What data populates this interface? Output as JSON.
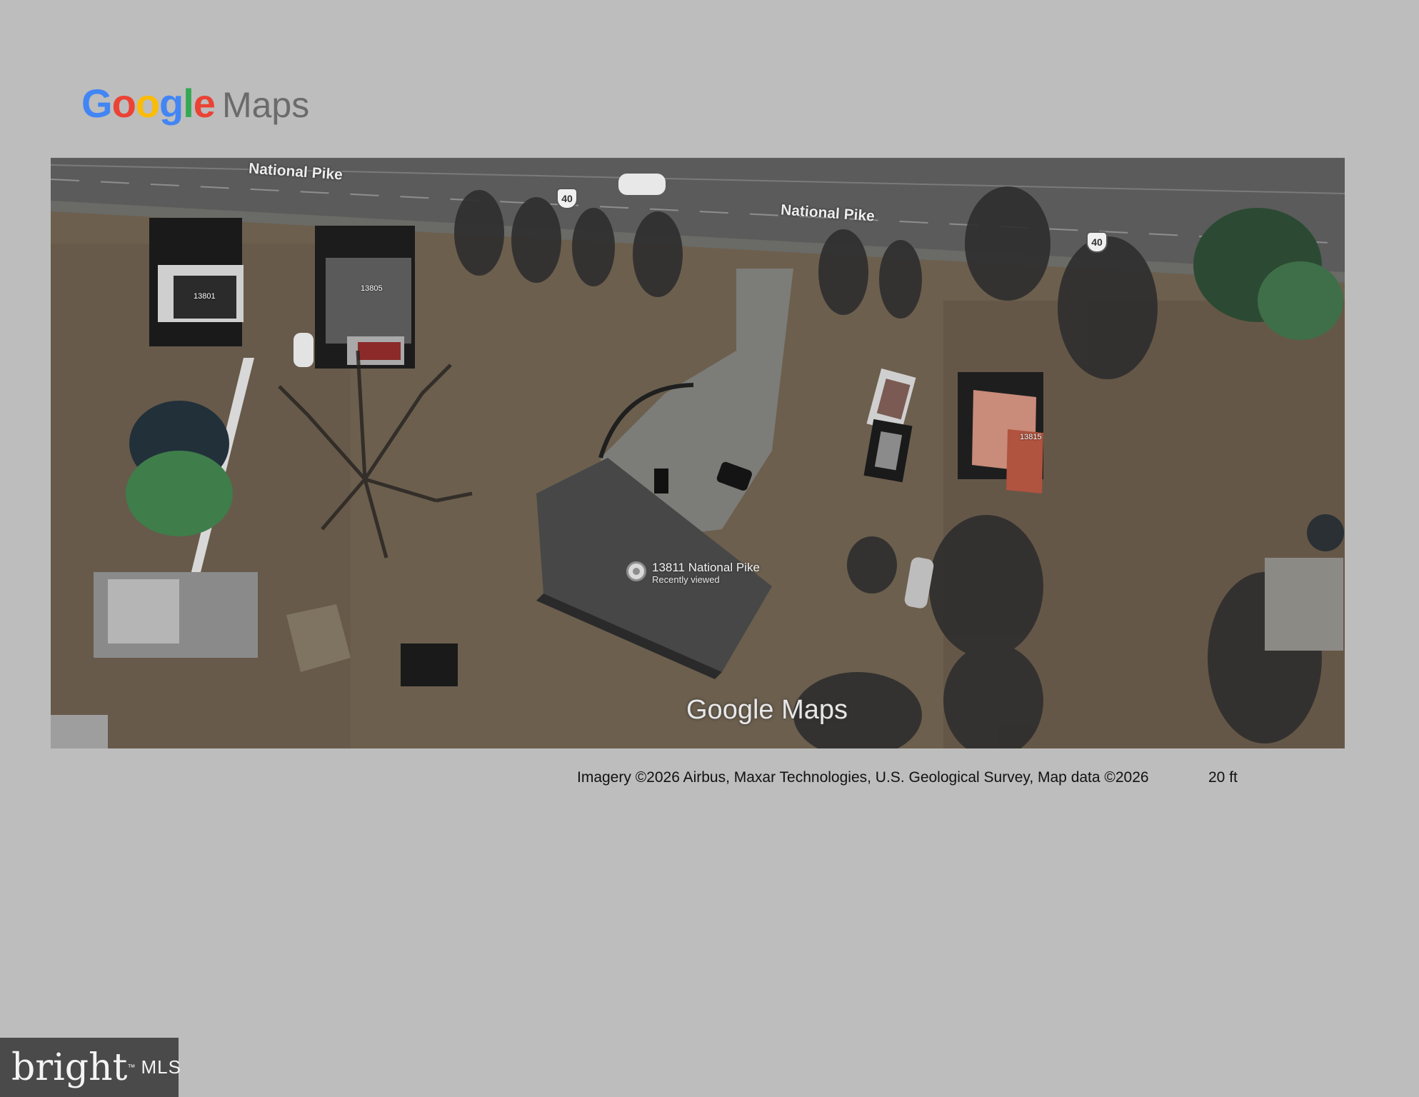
{
  "header": {
    "logo_google": "Google",
    "logo_maps": "Maps",
    "logo_colors": [
      "#4285F4",
      "#EA4335",
      "#FBBC05",
      "#4285F4",
      "#34A853",
      "#EA4335"
    ]
  },
  "map": {
    "road_labels": [
      "National Pike",
      "National Pike"
    ],
    "route_shields": [
      "40",
      "40"
    ],
    "house_numbers": [
      "13801",
      "13805",
      "13815"
    ],
    "pin": {
      "title": "13811 National Pike",
      "subtitle": "Recently viewed",
      "icon": "location-pin-icon"
    },
    "watermark": "Google Maps"
  },
  "footer": {
    "attribution": "Imagery ©2026 Airbus, Maxar Technologies, U.S. Geological Survey, Map data ©2026",
    "scale": "20 ft"
  },
  "badge": {
    "brand": "bright",
    "trademark": "™",
    "suffix": "MLS"
  }
}
